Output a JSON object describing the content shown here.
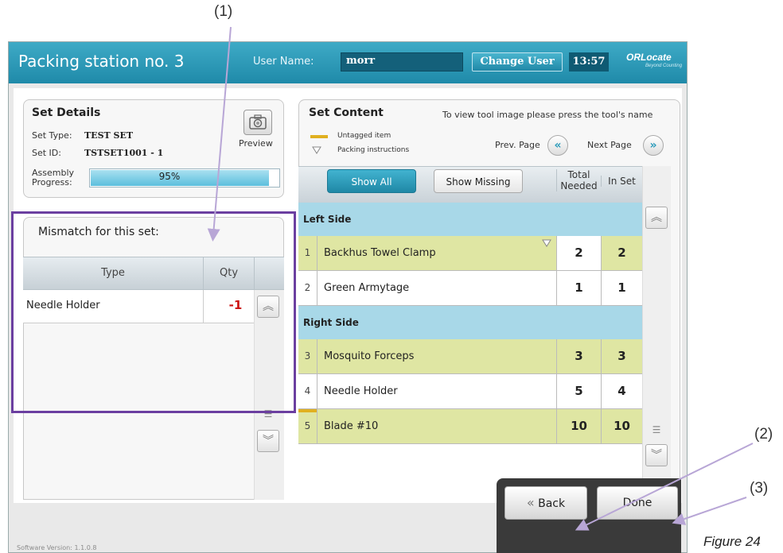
{
  "annotations": {
    "callout_1": "(1)",
    "callout_2": "(2)",
    "callout_3": "(3)",
    "figure_caption": "Figure 24"
  },
  "header": {
    "title": "Packing station no. 3",
    "user_name_label": "User Name:",
    "user_name_value": "morr",
    "change_user_label": "Change User",
    "clock": "13:57",
    "logo": "ORLocate",
    "logo_tagline": "Beyond Counting"
  },
  "set_details": {
    "title": "Set Details",
    "set_type_label": "Set Type:",
    "set_type_value": "TEST SET",
    "set_id_label": "Set ID:",
    "set_id_value": "TSTSET1001 - 1",
    "preview_label": "Preview",
    "progress_label_1": "Assembly",
    "progress_label_2": "Progress:",
    "progress_text": "95%",
    "progress_value": 0.95
  },
  "mismatch": {
    "title": "Mismatch for this set:",
    "col_type": "Type",
    "col_qty": "Qty",
    "rows": [
      {
        "type": "Needle Holder",
        "qty": "-1"
      }
    ]
  },
  "set_content": {
    "title": "Set Content",
    "hint": "To view tool image please press the tool's name",
    "legend_untagged": "Untagged item",
    "legend_packing": "Packing instructions",
    "prev_page": "Prev. Page",
    "next_page": "Next Page",
    "show_all": "Show All",
    "show_missing": "Show Missing",
    "col_total_1": "Total",
    "col_total_2": "Needed",
    "col_in_set": "In Set",
    "sections": [
      {
        "label": "Left Side"
      },
      {
        "label": "Right Side"
      }
    ],
    "items": [
      {
        "num": "1",
        "name": "Backhus Towel Clamp",
        "total": "2",
        "in_set": "2"
      },
      {
        "num": "2",
        "name": "Green Armytage",
        "total": "1",
        "in_set": "1"
      },
      {
        "num": "3",
        "name": "Mosquito Forceps",
        "total": "3",
        "in_set": "3"
      },
      {
        "num": "4",
        "name": "Needle Holder",
        "total": "5",
        "in_set": "4"
      },
      {
        "num": "5",
        "name": "Blade #10",
        "total": "10",
        "in_set": "10"
      }
    ]
  },
  "footer": {
    "back_label": "Back",
    "done_label": "Done",
    "version": "Software Version: 1.1.0.8"
  },
  "colors": {
    "header": "#2a9bbb",
    "highlight_box": "#6b3fa0",
    "mismatch_qty": "#cc1111",
    "tagged_row": "#dfe6a3",
    "section_row": "#a8d8e8",
    "untagged_marker": "#e0b020"
  }
}
